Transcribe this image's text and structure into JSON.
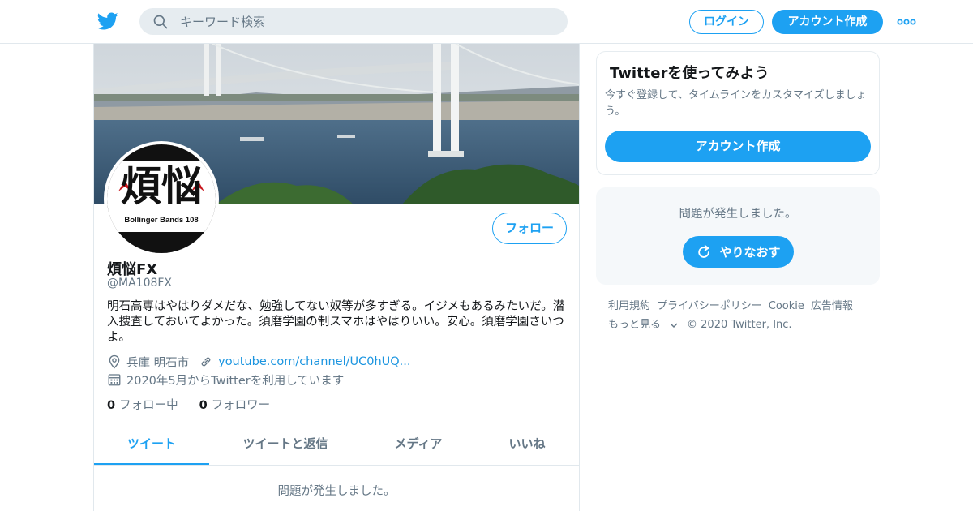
{
  "header": {
    "search_placeholder": "キーワード検索",
    "login_label": "ログイン",
    "signup_label": "アカウント作成"
  },
  "profile": {
    "avatar_text_main": "煩悩",
    "avatar_text_sub": "Bollinger Bands 108",
    "follow_label": "フォロー",
    "name": "煩悩FX",
    "handle": "@MA108FX",
    "bio": "明石高専はやはりダメだな、勉強してない奴等が多すぎる。イジメもあるみたいだ。潜入捜査しておいてよかった。須磨学園の制スマホはやはりいい。安心。須磨学園さいつよ。",
    "location": "兵庫 明石市",
    "url": "youtube.com/channel/UC0hUQ...",
    "joined": "2020年5月からTwitterを利用しています",
    "following_count": "0",
    "following_label": "フォロー中",
    "followers_count": "0",
    "followers_label": "フォロワー"
  },
  "tabs": [
    {
      "label": "ツイート"
    },
    {
      "label": "ツイートと返信"
    },
    {
      "label": "メディア"
    },
    {
      "label": "いいね"
    }
  ],
  "timeline_error": "問題が発生しました。",
  "signup_card": {
    "title": "Twitterを使ってみよう",
    "description": "今すぐ登録して、タイムラインをカスタマイズしましょう。",
    "button_label": "アカウント作成"
  },
  "error_card": {
    "message": "問題が発生しました。",
    "retry_label": "やりなおす"
  },
  "footer": {
    "links": [
      "利用規約",
      "プライバシーポリシー",
      "Cookie",
      "広告情報"
    ],
    "more_label": "もっと見る",
    "copyright": "© 2020 Twitter, Inc."
  },
  "colors": {
    "accent": "#1da1f2",
    "text_secondary": "#657786",
    "border": "#e1e8ed"
  },
  "icons": [
    "twitter-bird-icon",
    "search-icon",
    "more-dots-icon",
    "location-icon",
    "link-icon",
    "calendar-icon",
    "refresh-icon",
    "chevron-down-icon"
  ]
}
